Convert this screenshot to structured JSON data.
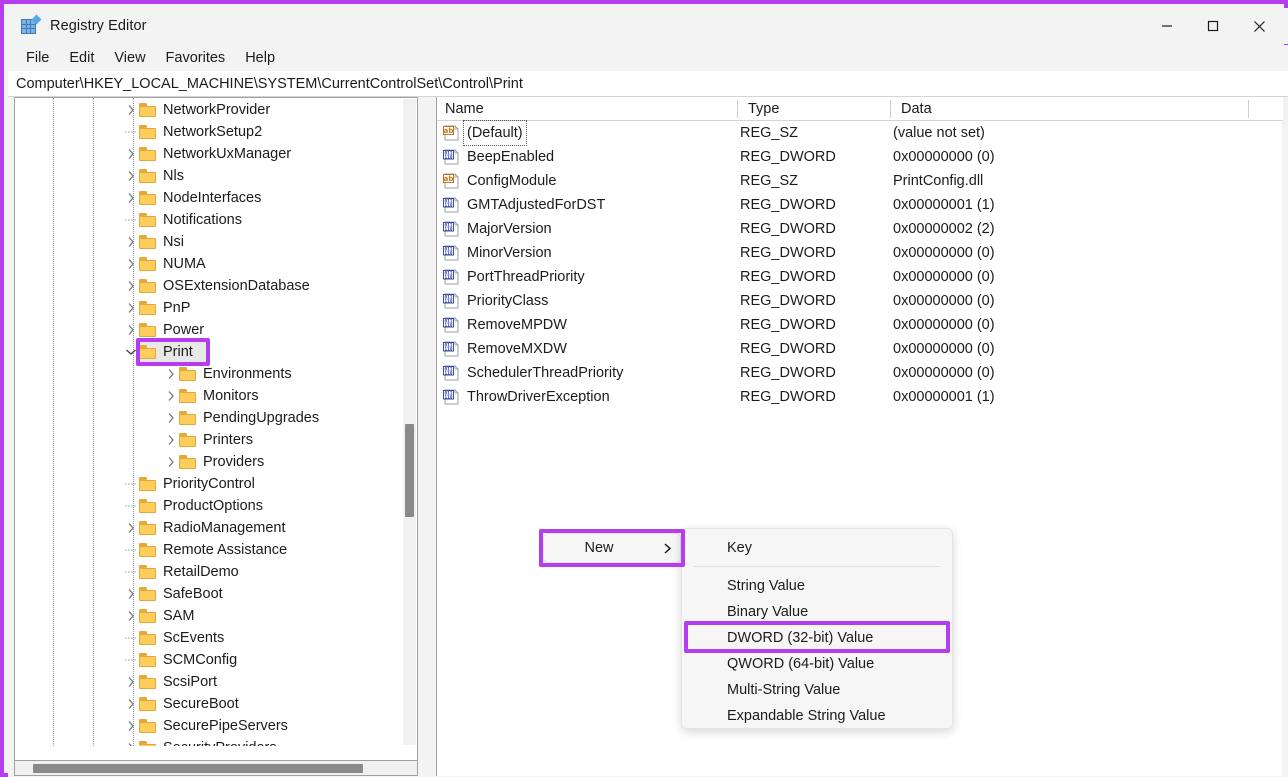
{
  "window": {
    "title": "Registry Editor",
    "icon": "registry-editor-icon",
    "controls": {
      "minimize": "minimize-icon",
      "maximize": "maximize-icon",
      "close": "close-icon"
    }
  },
  "menu_bar": {
    "items": [
      "File",
      "Edit",
      "View",
      "Favorites",
      "Help"
    ]
  },
  "address_bar": {
    "path": "Computer\\HKEY_LOCAL_MACHINE\\SYSTEM\\CurrentControlSet\\Control\\Print"
  },
  "tree": {
    "items": [
      {
        "label": "NetworkProvider",
        "depth": 3,
        "expander": "chevron",
        "selected": false
      },
      {
        "label": "NetworkSetup2",
        "depth": 3,
        "expander": "leaf",
        "selected": false
      },
      {
        "label": "NetworkUxManager",
        "depth": 3,
        "expander": "chevron",
        "selected": false
      },
      {
        "label": "Nls",
        "depth": 3,
        "expander": "chevron",
        "selected": false
      },
      {
        "label": "NodeInterfaces",
        "depth": 3,
        "expander": "chevron",
        "selected": false
      },
      {
        "label": "Notifications",
        "depth": 3,
        "expander": "leaf",
        "selected": false
      },
      {
        "label": "Nsi",
        "depth": 3,
        "expander": "chevron",
        "selected": false
      },
      {
        "label": "NUMA",
        "depth": 3,
        "expander": "chevron",
        "selected": false
      },
      {
        "label": "OSExtensionDatabase",
        "depth": 3,
        "expander": "chevron",
        "selected": false
      },
      {
        "label": "PnP",
        "depth": 3,
        "expander": "chevron",
        "selected": false
      },
      {
        "label": "Power",
        "depth": 3,
        "expander": "chevron",
        "selected": false
      },
      {
        "label": "Print",
        "depth": 3,
        "expander": "chevron-down",
        "selected": true
      },
      {
        "label": "Environments",
        "depth": 4,
        "expander": "chevron",
        "selected": false
      },
      {
        "label": "Monitors",
        "depth": 4,
        "expander": "chevron",
        "selected": false
      },
      {
        "label": "PendingUpgrades",
        "depth": 4,
        "expander": "chevron",
        "selected": false
      },
      {
        "label": "Printers",
        "depth": 4,
        "expander": "chevron",
        "selected": false
      },
      {
        "label": "Providers",
        "depth": 4,
        "expander": "chevron",
        "selected": false
      },
      {
        "label": "PriorityControl",
        "depth": 3,
        "expander": "leaf",
        "selected": false
      },
      {
        "label": "ProductOptions",
        "depth": 3,
        "expander": "leaf",
        "selected": false
      },
      {
        "label": "RadioManagement",
        "depth": 3,
        "expander": "chevron",
        "selected": false
      },
      {
        "label": "Remote Assistance",
        "depth": 3,
        "expander": "leaf",
        "selected": false
      },
      {
        "label": "RetailDemo",
        "depth": 3,
        "expander": "leaf",
        "selected": false
      },
      {
        "label": "SafeBoot",
        "depth": 3,
        "expander": "chevron",
        "selected": false
      },
      {
        "label": "SAM",
        "depth": 3,
        "expander": "chevron",
        "selected": false
      },
      {
        "label": "ScEvents",
        "depth": 3,
        "expander": "leaf",
        "selected": false
      },
      {
        "label": "SCMConfig",
        "depth": 3,
        "expander": "leaf",
        "selected": false
      },
      {
        "label": "ScsiPort",
        "depth": 3,
        "expander": "chevron",
        "selected": false
      },
      {
        "label": "SecureBoot",
        "depth": 3,
        "expander": "chevron",
        "selected": false
      },
      {
        "label": "SecurePipeServers",
        "depth": 3,
        "expander": "chevron",
        "selected": false
      },
      {
        "label": "SecurityProviders",
        "depth": 3,
        "expander": "chevron",
        "selected": false
      }
    ]
  },
  "values": {
    "columns": [
      "Name",
      "Type",
      "Data"
    ],
    "rows": [
      {
        "name": "(Default)",
        "type": "REG_SZ",
        "data": "(value not set)",
        "icon": "string-value-icon",
        "focused": true
      },
      {
        "name": "BeepEnabled",
        "type": "REG_DWORD",
        "data": "0x00000000 (0)",
        "icon": "dword-value-icon",
        "focused": false
      },
      {
        "name": "ConfigModule",
        "type": "REG_SZ",
        "data": "PrintConfig.dll",
        "icon": "string-value-icon",
        "focused": false
      },
      {
        "name": "GMTAdjustedForDST",
        "type": "REG_DWORD",
        "data": "0x00000001 (1)",
        "icon": "dword-value-icon",
        "focused": false
      },
      {
        "name": "MajorVersion",
        "type": "REG_DWORD",
        "data": "0x00000002 (2)",
        "icon": "dword-value-icon",
        "focused": false
      },
      {
        "name": "MinorVersion",
        "type": "REG_DWORD",
        "data": "0x00000000 (0)",
        "icon": "dword-value-icon",
        "focused": false
      },
      {
        "name": "PortThreadPriority",
        "type": "REG_DWORD",
        "data": "0x00000000 (0)",
        "icon": "dword-value-icon",
        "focused": false
      },
      {
        "name": "PriorityClass",
        "type": "REG_DWORD",
        "data": "0x00000000 (0)",
        "icon": "dword-value-icon",
        "focused": false
      },
      {
        "name": "RemoveMPDW",
        "type": "REG_DWORD",
        "data": "0x00000000 (0)",
        "icon": "dword-value-icon",
        "focused": false
      },
      {
        "name": "RemoveMXDW",
        "type": "REG_DWORD",
        "data": "0x00000000 (0)",
        "icon": "dword-value-icon",
        "focused": false
      },
      {
        "name": "SchedulerThreadPriority",
        "type": "REG_DWORD",
        "data": "0x00000000 (0)",
        "icon": "dword-value-icon",
        "focused": false
      },
      {
        "name": "ThrowDriverException",
        "type": "REG_DWORD",
        "data": "0x00000001 (1)",
        "icon": "dword-value-icon",
        "focused": false
      }
    ]
  },
  "context_menu": {
    "new_label": "New",
    "submenu_arrow": "chevron-right-icon",
    "submenu_items": [
      {
        "label": "Key",
        "highlighted": false,
        "separator_after": true
      },
      {
        "label": "String Value",
        "highlighted": false,
        "separator_after": false
      },
      {
        "label": "Binary Value",
        "highlighted": false,
        "separator_after": false
      },
      {
        "label": "DWORD (32-bit) Value",
        "highlighted": true,
        "separator_after": false
      },
      {
        "label": "QWORD (64-bit) Value",
        "highlighted": false,
        "separator_after": false
      },
      {
        "label": "Multi-String Value",
        "highlighted": false,
        "separator_after": false
      },
      {
        "label": "Expandable String Value",
        "highlighted": false,
        "separator_after": false
      }
    ]
  },
  "annotation": {
    "accent_color": "#b43df0",
    "targets": [
      "tree-item-print",
      "context-menu-new",
      "submenu-item-dword-32-bit-value"
    ]
  }
}
